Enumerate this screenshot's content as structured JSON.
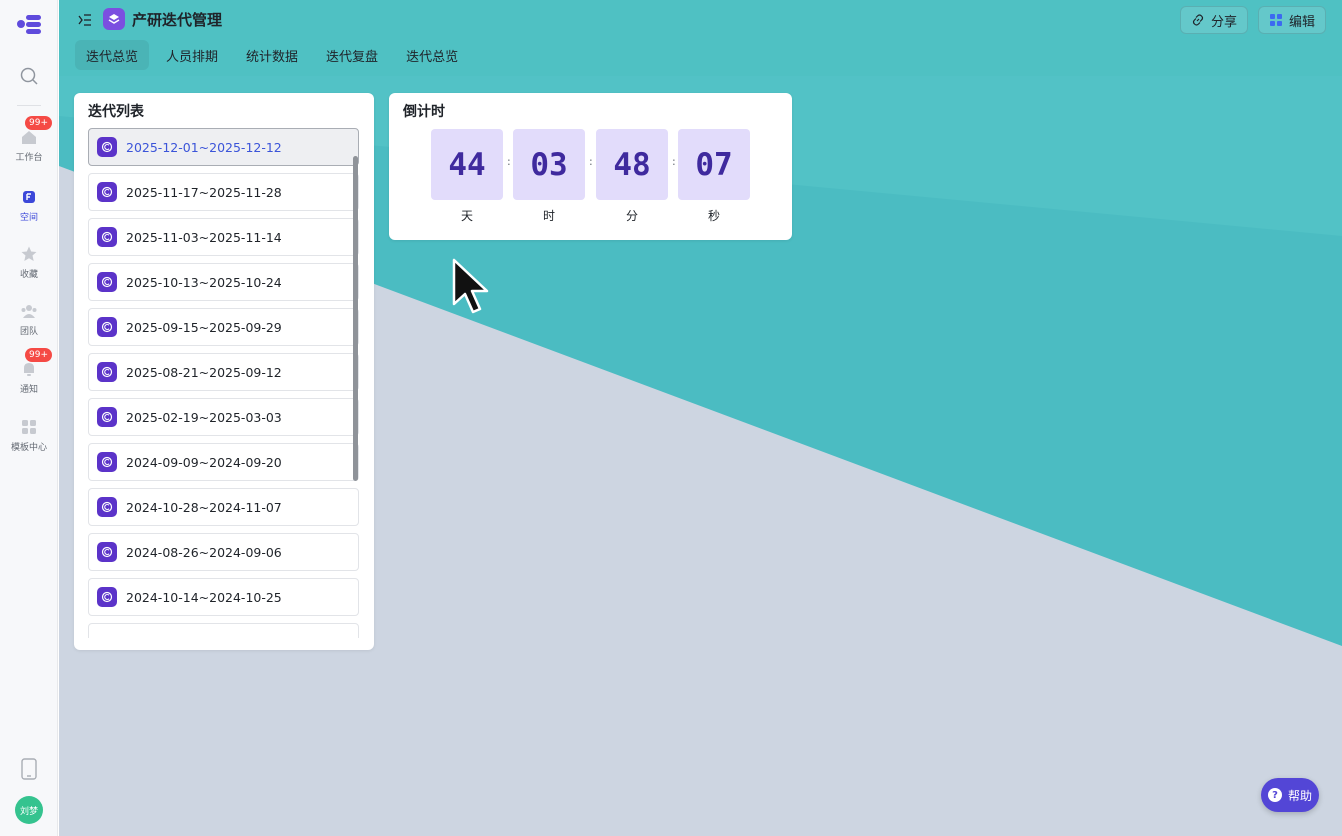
{
  "rail": {
    "items": [
      {
        "label": "工作台",
        "badge": "99+"
      },
      {
        "label": "空间"
      },
      {
        "label": "收藏"
      },
      {
        "label": "团队"
      },
      {
        "label": "通知",
        "badge": "99+"
      },
      {
        "label": "模板中心"
      }
    ],
    "avatar": "刘梦"
  },
  "header": {
    "title": "产研迭代管理",
    "share_label": "分享",
    "edit_label": "编辑",
    "tabs": [
      "迭代总览",
      "人员排期",
      "统计数据",
      "迭代复盘",
      "迭代总览"
    ]
  },
  "iteration_list": {
    "title": "迭代列表",
    "items": [
      "2025-12-01~2025-12-12",
      "2025-11-17~2025-11-28",
      "2025-11-03~2025-11-14",
      "2025-10-13~2025-10-24",
      "2025-09-15~2025-09-29",
      "2025-08-21~2025-09-12",
      "2025-02-19~2025-03-03",
      "2024-09-09~2024-09-20",
      "2024-10-28~2024-11-07",
      "2024-08-26~2024-09-06",
      "2024-10-14~2024-10-25"
    ]
  },
  "countdown": {
    "title": "倒计时",
    "days": "44",
    "hours": "03",
    "minutes": "48",
    "seconds": "07",
    "colon": ":",
    "unit_days": "天",
    "unit_hours": "时",
    "unit_minutes": "分",
    "unit_seconds": "秒"
  },
  "help": {
    "label": "帮助",
    "glyph": "?"
  },
  "colors": {
    "accent": "#5346d6",
    "header": "#4fc1c3",
    "digit_bg": "#e2dcfb"
  }
}
